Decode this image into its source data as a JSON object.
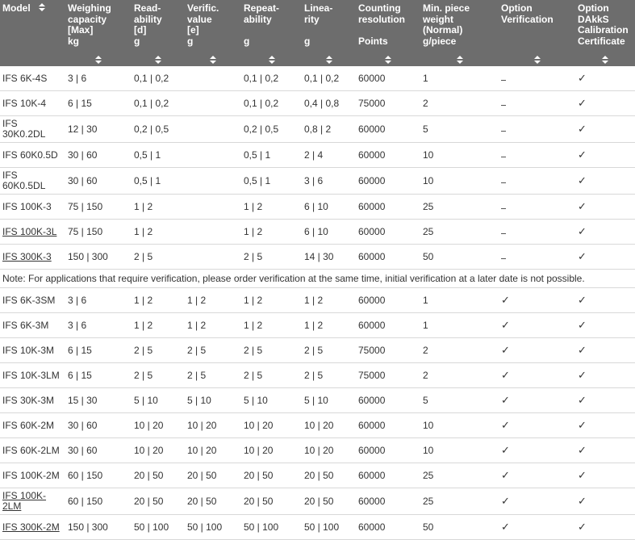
{
  "table": {
    "headers": [
      "Model",
      "Weighing\ncapacity\n[Max]\nkg",
      "Read-\nability\n[d]\ng",
      "Verific.\nvalue\n[e]\ng",
      "Repeat-\nability\n\ng",
      "Linea-\nrity\n\ng",
      "Counting\nresolution\n\nPoints",
      "Min. piece\nweight\n(Normal)\ng/piece",
      "Option\nVerification",
      "Option\nDAkkS\nCalibration\nCertificate"
    ],
    "check": "✓",
    "rows_a": [
      {
        "model": "IFS 6K-4S",
        "cap": "3 | 6",
        "read": "0,1 | 0,2",
        "verif": "",
        "rep": "0,1 | 0,2",
        "lin": "0,1 | 0,2",
        "count": "60000",
        "min": "1",
        "opt_verif": "dash",
        "dakks": "check",
        "link": false
      },
      {
        "model": "IFS 10K-4",
        "cap": "6 | 15",
        "read": "0,1 | 0,2",
        "verif": "",
        "rep": "0,1 | 0,2",
        "lin": "0,4 | 0,8",
        "count": "75000",
        "min": "2",
        "opt_verif": "dash",
        "dakks": "check",
        "link": false
      },
      {
        "model": "IFS 30K0.2DL",
        "cap": "12 | 30",
        "read": "0,2 | 0,5",
        "verif": "",
        "rep": "0,2 | 0,5",
        "lin": "0,8 | 2",
        "count": "60000",
        "min": "5",
        "opt_verif": "dash",
        "dakks": "check",
        "link": false
      },
      {
        "model": "IFS 60K0.5D",
        "cap": "30 | 60",
        "read": "0,5 | 1",
        "verif": "",
        "rep": "0,5 | 1",
        "lin": "2 | 4",
        "count": "60000",
        "min": "10",
        "opt_verif": "dash",
        "dakks": "check",
        "link": false
      },
      {
        "model": "IFS 60K0.5DL",
        "cap": "30 | 60",
        "read": "0,5 | 1",
        "verif": "",
        "rep": "0,5 | 1",
        "lin": "3 | 6",
        "count": "60000",
        "min": "10",
        "opt_verif": "dash",
        "dakks": "check",
        "link": false
      },
      {
        "model": "IFS 100K-3",
        "cap": "75 | 150",
        "read": "1 | 2",
        "verif": "",
        "rep": "1 | 2",
        "lin": "6 | 10",
        "count": "60000",
        "min": "25",
        "opt_verif": "dash",
        "dakks": "check",
        "link": false
      },
      {
        "model": "IFS 100K-3L",
        "cap": "75 | 150",
        "read": "1 | 2",
        "verif": "",
        "rep": "1 | 2",
        "lin": "6 | 10",
        "count": "60000",
        "min": "25",
        "opt_verif": "dash",
        "dakks": "check",
        "link": true
      },
      {
        "model": "IFS 300K-3",
        "cap": "150 | 300",
        "read": "2 | 5",
        "verif": "",
        "rep": "2 | 5",
        "lin": "14 | 30",
        "count": "60000",
        "min": "50",
        "opt_verif": "dash",
        "dakks": "check",
        "link": true
      }
    ],
    "note": "Note: For applications that require verification, please order verification at the same time, initial verification at a later date is not possible.",
    "rows_b": [
      {
        "model": "IFS 6K-3SM",
        "cap": "3 | 6",
        "read": "1 | 2",
        "verif": "1 | 2",
        "rep": "1 | 2",
        "lin": "1 | 2",
        "count": "60000",
        "min": "1",
        "opt_verif": "check",
        "dakks": "check",
        "link": false
      },
      {
        "model": "IFS 6K-3M",
        "cap": "3 | 6",
        "read": "1 | 2",
        "verif": "1 | 2",
        "rep": "1 | 2",
        "lin": "1 | 2",
        "count": "60000",
        "min": "1",
        "opt_verif": "check",
        "dakks": "check",
        "link": false
      },
      {
        "model": "IFS 10K-3M",
        "cap": "6 | 15",
        "read": "2 | 5",
        "verif": "2 | 5",
        "rep": "2 | 5",
        "lin": "2 | 5",
        "count": "75000",
        "min": "2",
        "opt_verif": "check",
        "dakks": "check",
        "link": false
      },
      {
        "model": "IFS 10K-3LM",
        "cap": "6 | 15",
        "read": "2 | 5",
        "verif": "2 | 5",
        "rep": "2 | 5",
        "lin": "2 | 5",
        "count": "75000",
        "min": "2",
        "opt_verif": "check",
        "dakks": "check",
        "link": false
      },
      {
        "model": "IFS 30K-3M",
        "cap": "15 | 30",
        "read": "5 | 10",
        "verif": "5 | 10",
        "rep": "5 | 10",
        "lin": "5 | 10",
        "count": "60000",
        "min": "5",
        "opt_verif": "check",
        "dakks": "check",
        "link": false
      },
      {
        "model": "IFS 60K-2M",
        "cap": "30 | 60",
        "read": "10 | 20",
        "verif": "10 | 20",
        "rep": "10 | 20",
        "lin": "10 | 20",
        "count": "60000",
        "min": "10",
        "opt_verif": "check",
        "dakks": "check",
        "link": false
      },
      {
        "model": "IFS 60K-2LM",
        "cap": "30 | 60",
        "read": "10 | 20",
        "verif": "10 | 20",
        "rep": "10 | 20",
        "lin": "10 | 20",
        "count": "60000",
        "min": "10",
        "opt_verif": "check",
        "dakks": "check",
        "link": false
      },
      {
        "model": "IFS 100K-2M",
        "cap": "60 | 150",
        "read": "20 | 50",
        "verif": "20 | 50",
        "rep": "20 | 50",
        "lin": "20 | 50",
        "count": "60000",
        "min": "25",
        "opt_verif": "check",
        "dakks": "check",
        "link": false
      },
      {
        "model": "IFS 100K-2LM",
        "cap": "60 | 150",
        "read": "20 | 50",
        "verif": "20 | 50",
        "rep": "20 | 50",
        "lin": "20 | 50",
        "count": "60000",
        "min": "25",
        "opt_verif": "check",
        "dakks": "check",
        "link": true
      },
      {
        "model": "IFS 300K-2M",
        "cap": "150 | 300",
        "read": "50 | 100",
        "verif": "50 | 100",
        "rep": "50 | 100",
        "lin": "50 | 100",
        "count": "60000",
        "min": "50",
        "opt_verif": "check",
        "dakks": "check",
        "link": true
      }
    ]
  }
}
